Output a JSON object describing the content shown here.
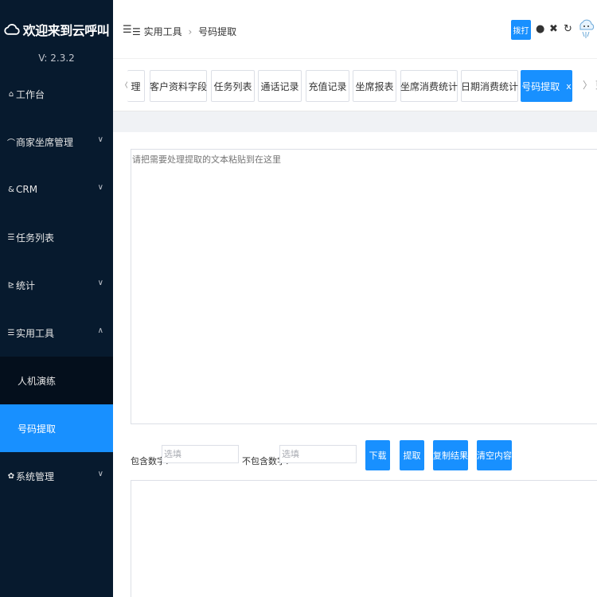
{
  "sidebar": {
    "title": "欢迎来到云呼叫",
    "version": "V: 2.3.2",
    "menu": [
      {
        "icon": "dashboard-icon",
        "glyph": "⌂",
        "label": "工作台"
      },
      {
        "icon": "headset-icon",
        "glyph": "⌒",
        "label": "商家坐席管理"
      },
      {
        "icon": "user-icon",
        "glyph": "&",
        "label": "CRM"
      },
      {
        "icon": "list-icon",
        "glyph": "☰",
        "label": "任务列表"
      },
      {
        "icon": "chart-icon",
        "glyph": "⊵",
        "label": "统计"
      },
      {
        "icon": "tools-icon",
        "glyph": "☰",
        "label": "实用工具"
      }
    ],
    "submenu": [
      {
        "label": "人机演练"
      },
      {
        "label": "号码提取"
      }
    ],
    "system": {
      "icon": "gear-icon",
      "glyph": "✿",
      "label": "系统管理"
    }
  },
  "header": {
    "breadcrumb": [
      "实用工具",
      "号码提取"
    ],
    "dial_label": "拨打"
  },
  "tabs": [
    {
      "label": "理"
    },
    {
      "label": "客户资料字段"
    },
    {
      "label": "任务列表"
    },
    {
      "label": "通话记录"
    },
    {
      "label": "充值记录"
    },
    {
      "label": "坐席报表"
    },
    {
      "label": "坐席消费统计"
    },
    {
      "label": "日期消费统计"
    },
    {
      "label": "号码提取",
      "close": "x"
    }
  ],
  "tabs_more": "更",
  "form": {
    "input_placeholder": "请把需要处理提取的文本粘贴到在这里",
    "include_label": "包含数字:",
    "include_placeholder": "选填",
    "exclude_label": "不包含数字:",
    "exclude_placeholder": "选填",
    "buttons": {
      "download": "下载",
      "extract": "提取",
      "copy": "复制结果",
      "clear": "清空内容"
    }
  },
  "colors": {
    "sidebar_bg": "#071a2e",
    "accent": "#1890ff"
  }
}
